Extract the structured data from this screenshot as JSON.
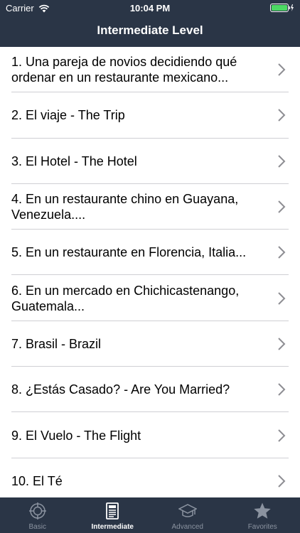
{
  "status": {
    "carrier": "Carrier",
    "time": "10:04 PM"
  },
  "nav": {
    "title": "Intermediate Level"
  },
  "lessons": [
    {
      "label": "1. Una pareja de novios decidiendo qué ordenar en un restaurante mexicano..."
    },
    {
      "label": "2. El viaje - The Trip"
    },
    {
      "label": "3. El Hotel - The Hotel"
    },
    {
      "label": "4. En un restaurante chino en Guayana, Venezuela...."
    },
    {
      "label": "5. En un restaurante en Florencia, Italia..."
    },
    {
      "label": "6. En un mercado en Chichicastenango, Guatemala..."
    },
    {
      "label": "7. Brasil - Brazil"
    },
    {
      "label": "8. ¿Estás Casado? - Are You Married?"
    },
    {
      "label": "9. El Vuelo - The Flight"
    },
    {
      "label": "10. El Té"
    }
  ],
  "tabs": [
    {
      "label": "Basic",
      "icon": "target-icon",
      "active": false
    },
    {
      "label": "Intermediate",
      "icon": "document-icon",
      "active": true
    },
    {
      "label": "Advanced",
      "icon": "graduation-cap-icon",
      "active": false
    },
    {
      "label": "Favorites",
      "icon": "star-icon",
      "active": false
    }
  ],
  "colors": {
    "header_bg": "#2a3546",
    "battery": "#4cd964"
  }
}
